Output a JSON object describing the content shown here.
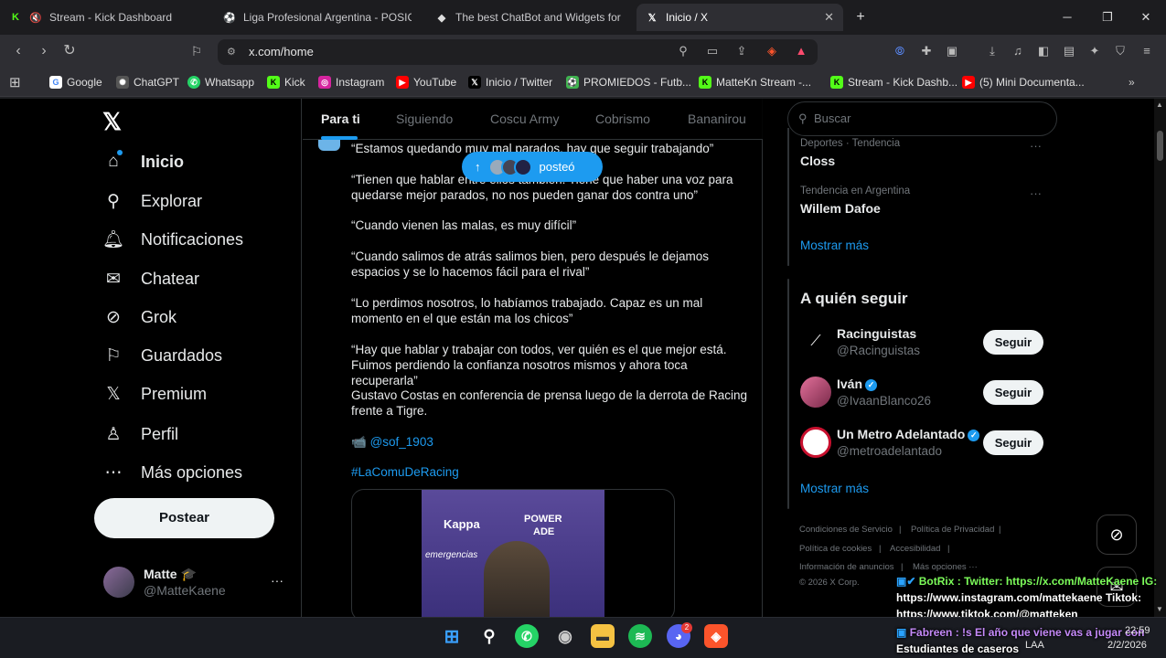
{
  "tabs": [
    {
      "label": "Stream - Kick Dashboard",
      "icon": "K",
      "color": "#53fc18",
      "muted": true
    },
    {
      "label": "Liga Profesional Argentina - POSICIO",
      "icon": "⚽",
      "color": "#3fb34f"
    },
    {
      "label": "The best ChatBot and Widgets for Ki",
      "icon": "◆",
      "color": "#dddddd"
    },
    {
      "label": "Inicio / X",
      "icon": "𝕏",
      "color": "#ffffff",
      "close": "✕"
    }
  ],
  "url": "x.com/home",
  "bookmarks": [
    {
      "label": "Google",
      "icon": "G",
      "color": "#4285f4"
    },
    {
      "label": "ChatGPT",
      "icon": "✺",
      "color": "#666"
    },
    {
      "label": "Whatsapp",
      "icon": "✆",
      "color": "#25d366"
    },
    {
      "label": "Kick",
      "icon": "K",
      "color": "#53fc18"
    },
    {
      "label": "Instagram",
      "icon": "◎",
      "color": "#d6249f"
    },
    {
      "label": "YouTube",
      "icon": "▶",
      "color": "#ff0000"
    },
    {
      "label": "Inicio / Twitter",
      "icon": "𝕏",
      "color": "#000"
    },
    {
      "label": "PROMIEDOS - Futb...",
      "icon": "⚽",
      "color": "#3fb34f"
    },
    {
      "label": "MatteKn Stream -...",
      "icon": "K",
      "color": "#53fc18"
    },
    {
      "label": "Stream - Kick Dashb...",
      "icon": "K",
      "color": "#53fc18"
    },
    {
      "label": "(5) Mini Documenta...",
      "icon": "▶",
      "color": "#ff0000"
    }
  ],
  "nav": [
    {
      "label": "Inicio",
      "icon": "⌂"
    },
    {
      "label": "Explorar",
      "icon": "⚲"
    },
    {
      "label": "Notificaciones",
      "icon": "🔔"
    },
    {
      "label": "Chatear",
      "icon": "✉"
    },
    {
      "label": "Grok",
      "icon": "⊘"
    },
    {
      "label": "Guardados",
      "icon": "⚐"
    },
    {
      "label": "Premium",
      "icon": "𝕏"
    },
    {
      "label": "Perfil",
      "icon": "♙"
    },
    {
      "label": "Más opciones",
      "icon": "⋯"
    }
  ],
  "post_button": "Postear",
  "user": {
    "name": "Matte 🎓",
    "handle": "@MatteKaene",
    "more": "···"
  },
  "feed_tabs": [
    "Para ti",
    "Siguiendo",
    "Coscu Army",
    "Cobrismo",
    "Bananirou"
  ],
  "new_posts_pill": {
    "arrow": "↑",
    "label": "posteó"
  },
  "post": {
    "p1": "“Estamos quedando muy mal parados, hay que seguir trabajando”",
    "p2": "“Tienen que hablar entre ellos también. Tiene que haber una voz para quedarse mejor parados, no nos pueden ganar dos contra uno”",
    "p3": "“Cuando vienen las malas, es muy difícil”",
    "p4": "“Cuando salimos de atrás salimos bien, pero después le dejamos espacios y se lo hacemos fácil para el rival”",
    "p5": "“Lo perdimos nosotros, lo habíamos trabajado. Capaz es un mal momento en el que están ma los chicos”",
    "p6": "“Hay que hablar y trabajar con todos, ver quién es el que mejor está. Fuimos perdiendo la  confianza nosotros mismos y ahora toca recuperarla”",
    "p7": "Gustavo Costas en conferencia de prensa luego de la derrota de Racing frente a Tigre.",
    "credit_icon": "📹",
    "credit": "@sof_1903",
    "hashtag": "#LaComuDeRacing",
    "media_text": {
      "kappa": "Kappa",
      "power": "POWER",
      "ade": "ADE",
      "emergencias": "emergencias"
    }
  },
  "search_placeholder": "Buscar",
  "trends": [
    {
      "meta": "Deportes · Tendencia",
      "name": "Closs",
      "more": "···"
    },
    {
      "meta": "Tendencia en Argentina",
      "name": "Willem Dafoe",
      "more": "···"
    }
  ],
  "show_more": "Mostrar más",
  "who_to_follow": {
    "title": "A quién seguir",
    "follow_label": "Seguir",
    "accounts": [
      {
        "name": "Racinguistas",
        "handle": "@Racinguistas",
        "verified": false
      },
      {
        "name": "Iván",
        "handle": "@IvaanBlanco26",
        "verified": true
      },
      {
        "name": "Un Metro Adelantado",
        "handle": "@metroadelantado",
        "verified": true
      }
    ],
    "show_more": "Mostrar más"
  },
  "footer": {
    "terms": "Condiciones de Servicio",
    "privacy": "Política de Privacidad",
    "cookies": "Política de cookies",
    "access": "Accesibilidad",
    "ads": "Información de anuncios",
    "more": "Más opciones ···",
    "copy": "© 2026 X Corp."
  },
  "chat_overlay": {
    "l1": "BotRix : Twitter: https://x.com/MatteKaene IG:",
    "l2": "https://www.instagram.com/mattekaene Tiktok:",
    "l3": "https://www.tiktok.com/@matteken",
    "l4": "Fabreen : !s El año que viene vas a jugar con",
    "l5": "Estudiantes de caseros"
  },
  "taskbar": {
    "lang": "LAA",
    "time": "22:59",
    "date": "2/2/2026",
    "discord_badge": "2"
  }
}
